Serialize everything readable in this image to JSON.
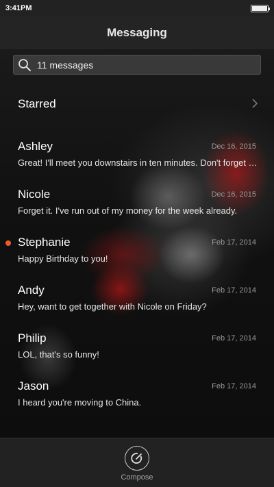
{
  "status": {
    "time": "3:41PM",
    "battery_level": 1.0
  },
  "header": {
    "title": "Messaging"
  },
  "search": {
    "text": "11 messages"
  },
  "starred": {
    "label": "Starred"
  },
  "conversations": [
    {
      "name": "Ashley",
      "date": "Dec 16, 2015",
      "preview": "Great! I'll meet you downstairs in ten minutes. Don't forget the tickets!",
      "unread": false
    },
    {
      "name": "Nicole",
      "date": "Dec 16, 2015",
      "preview": "Forget it. I've run out of my money for the week already.",
      "unread": false
    },
    {
      "name": "Stephanie",
      "date": "Feb 17, 2014",
      "preview": "Happy Birthday to you!",
      "unread": true
    },
    {
      "name": "Andy",
      "date": "Feb 17, 2014",
      "preview": "Hey, want to get together with Nicole on Friday?",
      "unread": false
    },
    {
      "name": "Philip",
      "date": "Feb 17, 2014",
      "preview": "LOL, that's so funny!",
      "unread": false
    },
    {
      "name": "Jason",
      "date": "Feb 17, 2014",
      "preview": "I heard you're moving to China.",
      "unread": false
    }
  ],
  "bottom": {
    "compose_label": "Compose"
  },
  "colors": {
    "unread_dot": "#f05a28",
    "header_bg": "#242424"
  },
  "icons": {
    "search": "magnifier-icon",
    "compose": "compose-icon",
    "chevron": "chevron-right-icon"
  }
}
